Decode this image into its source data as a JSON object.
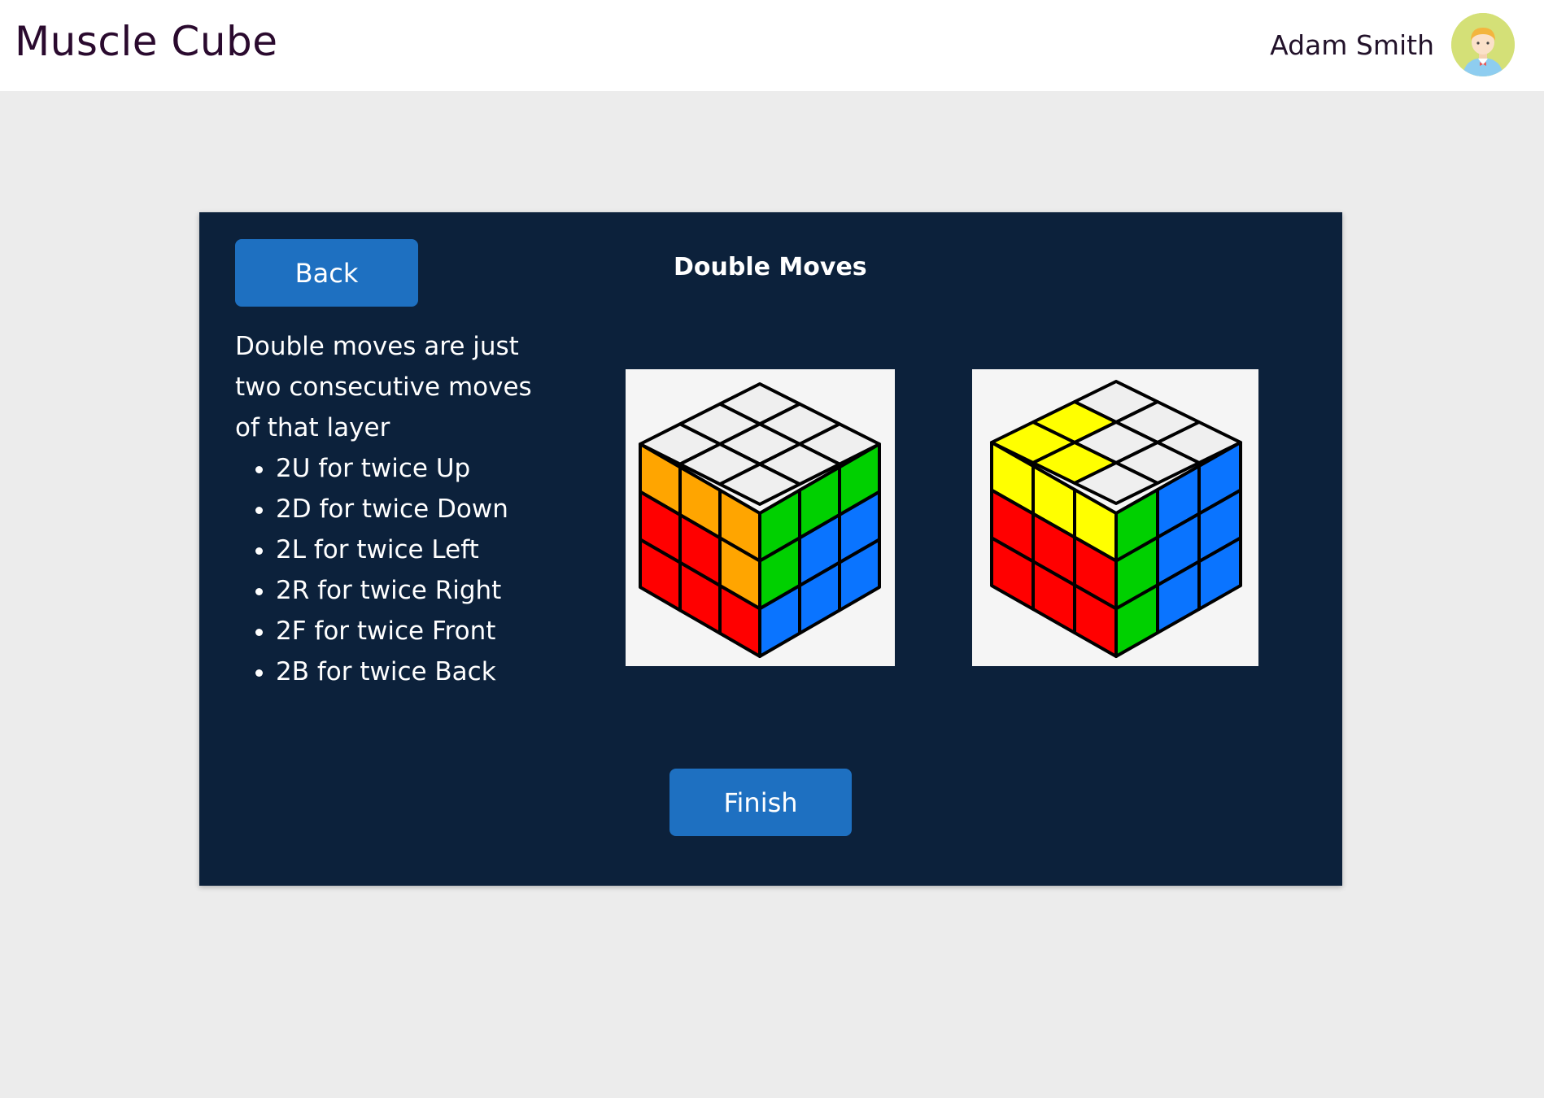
{
  "header": {
    "app_title": "Muscle Cube",
    "user_name": "Adam Smith",
    "avatar_icon": "user-avatar-icon"
  },
  "lesson": {
    "back_label": "Back",
    "title": "Double Moves",
    "intro": "Double moves are just two consecutive moves of that layer",
    "moves": [
      "2U for twice Up",
      "2D for twice Down",
      "2L for twice Left",
      "2R for twice Right",
      "2F for twice Front",
      "2B for twice Back"
    ],
    "finish_label": "Finish"
  },
  "colors": {
    "card_background": "#0c213b",
    "button": "#1e70c1",
    "page_background": "#ececec",
    "cube_white": "#efefef",
    "cube_red": "#ff0000",
    "cube_orange": "#ffa500",
    "cube_green": "#00d000",
    "cube_blue": "#0a74ff",
    "cube_yellow": "#ffff00"
  },
  "cubes": [
    {
      "name": "cube-before",
      "top": [
        "W",
        "W",
        "W",
        "W",
        "W",
        "W",
        "W",
        "W",
        "W"
      ],
      "left": [
        "O",
        "O",
        "O",
        "R",
        "R",
        "O",
        "R",
        "R",
        "R"
      ],
      "right": [
        "G",
        "G",
        "G",
        "G",
        "B",
        "B",
        "B",
        "B",
        "B"
      ]
    },
    {
      "name": "cube-after",
      "top": [
        "W",
        "W",
        "W",
        "Y",
        "W",
        "W",
        "Y",
        "Y",
        "W"
      ],
      "left": [
        "Y",
        "Y",
        "Y",
        "R",
        "R",
        "R",
        "R",
        "R",
        "R"
      ],
      "right": [
        "G",
        "B",
        "B",
        "G",
        "B",
        "B",
        "G",
        "B",
        "B"
      ]
    }
  ]
}
